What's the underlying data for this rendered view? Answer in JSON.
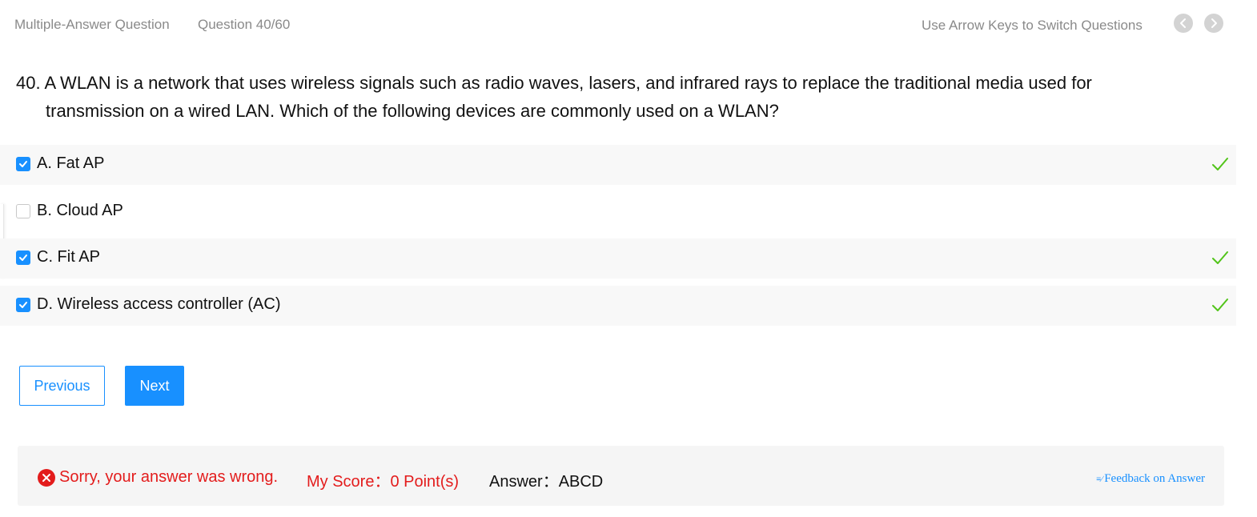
{
  "header": {
    "question_type": "Multiple-Answer Question",
    "question_counter": "Question 40/60",
    "nav_hint": "Use Arrow Keys to Switch Questions",
    "prev_icon": "chevron-left-icon",
    "next_icon": "chevron-right-icon"
  },
  "question": {
    "line1": "40. A WLAN is a network that uses wireless signals such as radio waves, lasers, and infrared rays to replace the traditional media used for",
    "line2": "transmission on a wired LAN. Which of the following devices are commonly used on a WLAN?"
  },
  "options": [
    {
      "label": "A. Fat AP",
      "checked": true,
      "correct": true
    },
    {
      "label": "B. Cloud AP",
      "checked": false,
      "correct": false
    },
    {
      "label": "C. Fit AP",
      "checked": true,
      "correct": true
    },
    {
      "label": "D. Wireless access controller (AC)",
      "checked": true,
      "correct": true
    }
  ],
  "buttons": {
    "previous": "Previous",
    "next": "Next"
  },
  "result": {
    "message": "Sorry, your answer was wrong.",
    "score": "My Score：0 Point(s)",
    "answer": "Answer：ABCD",
    "feedback_icon": "≡∕",
    "feedback": "Feedback on Answer"
  },
  "colors": {
    "accent": "#1890ff",
    "error": "#e31c1c",
    "correct_tick": "#52c41a"
  }
}
